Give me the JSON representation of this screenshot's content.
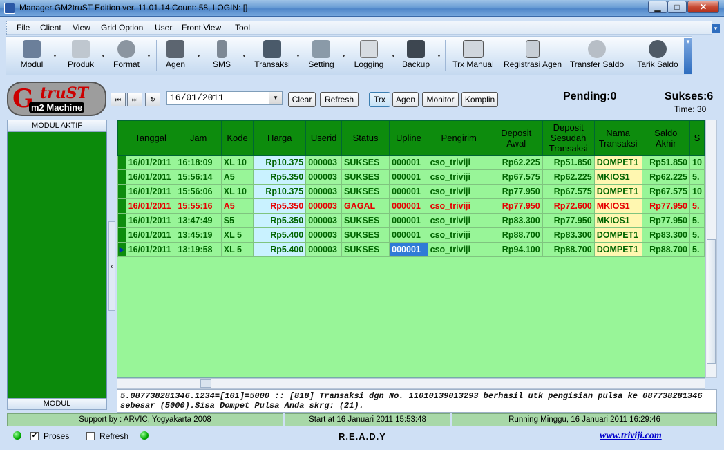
{
  "window": {
    "title": "Manager GM2truST Edition ver. 11.01.14 Count: 58, LOGIN: []",
    "min_label": "▁",
    "max_label": "□",
    "close_label": "✕"
  },
  "menu": [
    "File",
    "Client",
    "View",
    "Grid Option",
    "User",
    "Front View",
    "Tool"
  ],
  "toolbar": [
    {
      "label": "Modul",
      "icon": "users-icon",
      "color": "#6b7f9a"
    },
    {
      "label": "Produk",
      "icon": "papers-icon",
      "color": "#bfc7cf"
    },
    {
      "label": "Format",
      "icon": "gear-icon",
      "color": "#8b95a0"
    },
    {
      "label": "Agen",
      "icon": "people-icon",
      "color": "#5c6570"
    },
    {
      "label": "SMS",
      "icon": "phone-icon",
      "color": "#7d8894"
    },
    {
      "label": "Transaksi",
      "icon": "monitor-icon",
      "color": "#4a5a6a"
    },
    {
      "label": "Setting",
      "icon": "window-icon",
      "color": "#8a9aa8"
    },
    {
      "label": "Logging",
      "icon": "hand-icon",
      "color": "#d7dce1"
    },
    {
      "label": "Backup",
      "icon": "disk-icon",
      "color": "#3d4650"
    },
    {
      "label": "Trx Manual",
      "icon": "form-icon",
      "color": "#d0d6dd"
    },
    {
      "label": "Registrasi Agen",
      "icon": "tree-icon",
      "color": "#c7ced6"
    },
    {
      "label": "Transfer Saldo",
      "icon": "pie-icon",
      "color": "#b7bec6"
    },
    {
      "label": "Tarik Saldo",
      "icon": "no-icon",
      "color": "#4f5a66"
    }
  ],
  "logo": {
    "g": "G",
    "trust": "truST",
    "m2": "m2 Machine"
  },
  "controls": {
    "date": "16/01/2011",
    "clear": "Clear",
    "refresh": "Refresh",
    "trx": "Trx",
    "agen": "Agen",
    "monitor": "Monitor",
    "komplin": "Komplin",
    "pending": "Pending:0",
    "sukses": "Sukses:6",
    "time": "Time: 30"
  },
  "left_panel": {
    "header": "MODUL AKTIF",
    "footer": "MODUL"
  },
  "grid": {
    "columns": [
      "Tanggal",
      "Jam",
      "Kode",
      "Harga",
      "Userid",
      "Status",
      "Upline",
      "Pengirim",
      "Deposit Awal",
      "Deposit Sesudah Transaksi",
      "Nama Transaksi",
      "Saldo Akhir",
      "S"
    ],
    "rows": [
      {
        "tanggal": "16/01/2011",
        "jam": "16:18:09",
        "kode": "XL 10",
        "harga": "Rp10.375",
        "userid": "000003",
        "status": "SUKSES",
        "upline": "000001",
        "pengirim": "cso_triviji",
        "dep_awal": "Rp62.225",
        "dep_sesudah": "Rp51.850",
        "nama": "DOMPET1",
        "saldo": "Rp51.850",
        "s": "10"
      },
      {
        "tanggal": "16/01/2011",
        "jam": "15:56:14",
        "kode": "A5",
        "harga": "Rp5.350",
        "userid": "000003",
        "status": "SUKSES",
        "upline": "000001",
        "pengirim": "cso_triviji",
        "dep_awal": "Rp67.575",
        "dep_sesudah": "Rp62.225",
        "nama": "MKIOS1",
        "saldo": "Rp62.225",
        "s": "5."
      },
      {
        "tanggal": "16/01/2011",
        "jam": "15:56:06",
        "kode": "XL 10",
        "harga": "Rp10.375",
        "userid": "000003",
        "status": "SUKSES",
        "upline": "000001",
        "pengirim": "cso_triviji",
        "dep_awal": "Rp77.950",
        "dep_sesudah": "Rp67.575",
        "nama": "DOMPET1",
        "saldo": "Rp67.575",
        "s": "10"
      },
      {
        "tanggal": "16/01/2011",
        "jam": "15:55:16",
        "kode": "A5",
        "harga": "Rp5.350",
        "userid": "000003",
        "status": "GAGAL",
        "upline": "000001",
        "pengirim": "cso_triviji",
        "dep_awal": "Rp77.950",
        "dep_sesudah": "Rp72.600",
        "nama": "MKIOS1",
        "saldo": "Rp77.950",
        "s": "5."
      },
      {
        "tanggal": "16/01/2011",
        "jam": "13:47:49",
        "kode": "S5",
        "harga": "Rp5.350",
        "userid": "000003",
        "status": "SUKSES",
        "upline": "000001",
        "pengirim": "cso_triviji",
        "dep_awal": "Rp83.300",
        "dep_sesudah": "Rp77.950",
        "nama": "MKIOS1",
        "saldo": "Rp77.950",
        "s": "5."
      },
      {
        "tanggal": "16/01/2011",
        "jam": "13:45:19",
        "kode": "XL 5",
        "harga": "Rp5.400",
        "userid": "000003",
        "status": "SUKSES",
        "upline": "000001",
        "pengirim": "cso_triviji",
        "dep_awal": "Rp88.700",
        "dep_sesudah": "Rp83.300",
        "nama": "DOMPET1",
        "saldo": "Rp83.300",
        "s": "5."
      },
      {
        "tanggal": "16/01/2011",
        "jam": "13:19:58",
        "kode": "XL 5",
        "harga": "Rp5.400",
        "userid": "000003",
        "status": "SUKSES",
        "upline": "000001",
        "pengirim": "cso_triviji",
        "dep_awal": "Rp94.100",
        "dep_sesudah": "Rp88.700",
        "nama": "DOMPET1",
        "saldo": "Rp88.700",
        "s": "5."
      }
    ]
  },
  "message": "5.087738281346.1234=[101]=5000 :: [818] Transaksi dgn No. 11010139013293 berhasil utk pengisian pulsa ke 087738281346 sebesar (5000).Sisa Dompet Pulsa Anda skrg: (21).",
  "status": {
    "support": "Support by : ARVIC, Yogyakarta 2008",
    "start": "Start at 16 Januari 2011 15:53:48",
    "running": "Running   Minggu, 16 Januari 2011 16:29:46"
  },
  "bottom": {
    "proses": "Proses",
    "refresh": "Refresh",
    "ready": "R.E.A.D.Y",
    "website": "www.triviji.com"
  }
}
